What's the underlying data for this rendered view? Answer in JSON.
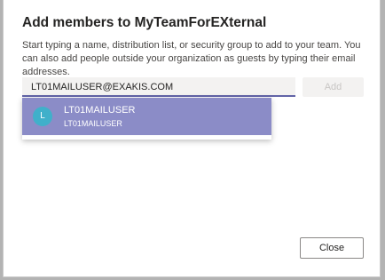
{
  "dialog": {
    "title": "Add members to MyTeamForEXternal",
    "description": "Start typing a name, distribution list, or security group to add to your team. You can also add people outside your organization as guests by typing their email addresses."
  },
  "search": {
    "value": "LT01MAILUSER@EXAKIS.COM"
  },
  "add_button": {
    "label": "Add"
  },
  "suggestions": [
    {
      "avatar_initial": "L",
      "name": "LT01MAILUSER",
      "subtext": "LT01MAILUSER"
    }
  ],
  "close_button": {
    "label": "Close"
  },
  "colors": {
    "accent": "#6264a7",
    "highlight": "#8b8cc7",
    "avatar": "#40b0ca"
  }
}
